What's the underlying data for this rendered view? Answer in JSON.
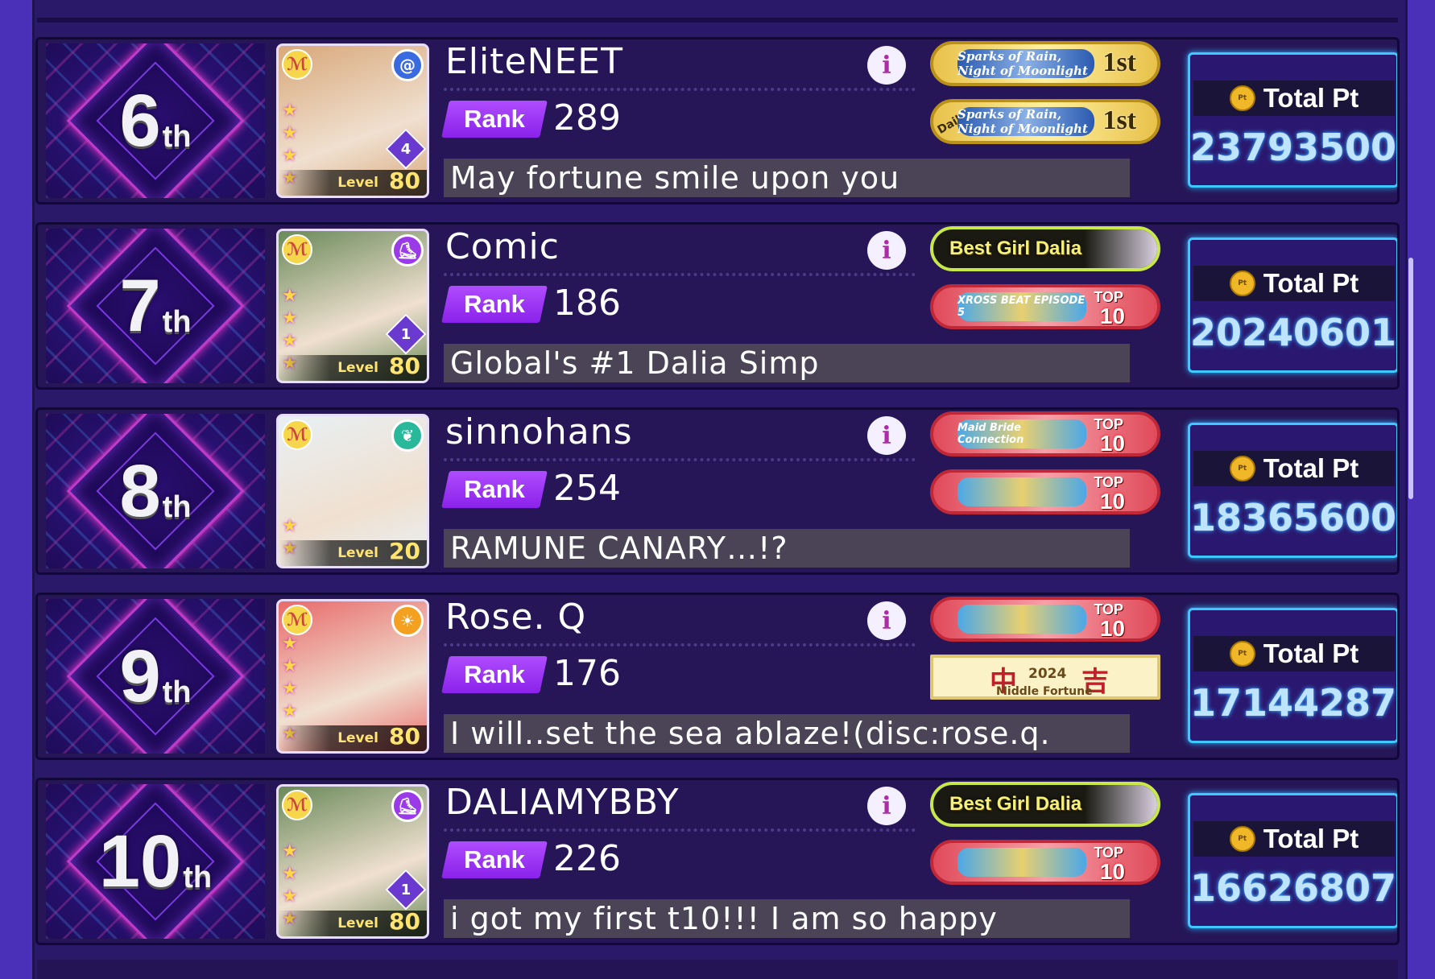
{
  "labels": {
    "rank": "Rank",
    "level": "Level",
    "total_pt": "Total Pt",
    "coin": "Pt"
  },
  "rows": [
    {
      "place": "6",
      "suffix": "th",
      "name": "EliteNEET",
      "rank": "289",
      "comment": "May fortune smile upon you",
      "card": {
        "level": "80",
        "train": "4",
        "attr_color": "#3a6ae0",
        "attr_icon": "spiral-icon",
        "band_icon": "band-logo-icon",
        "bg": "#d8a87a",
        "stars": 4
      },
      "badges": [
        {
          "style": "gold",
          "art": "Sparks of Rain, Night of Moonlight",
          "place": "1st",
          "daily": ""
        },
        {
          "style": "gold",
          "art": "Sparks of Rain, Night of Moonlight",
          "place": "1st",
          "daily": "Daily"
        }
      ],
      "total_pt": "23793500"
    },
    {
      "place": "7",
      "suffix": "th",
      "name": "Comic",
      "rank": "186",
      "comment": "Global's #1 Dalia Simp",
      "card": {
        "level": "80",
        "train": "1",
        "attr_color": "#9a3ae8",
        "attr_icon": "shoe-icon",
        "band_icon": "band-logo-icon",
        "bg": "#6a8a5a",
        "stars": 4
      },
      "badges": [
        {
          "style": "dark",
          "text": "Best Girl Dalia"
        },
        {
          "style": "red",
          "art": "XROSS BEAT EPISODE 5",
          "top": "TOP",
          "ten": "10"
        }
      ],
      "total_pt": "20240601"
    },
    {
      "place": "8",
      "suffix": "th",
      "name": "sinnohans",
      "rank": "254",
      "comment": "RAMUNE CANARY…!?",
      "card": {
        "level": "20",
        "train": "",
        "attr_color": "#2ab89a",
        "attr_icon": "leaf-icon",
        "band_icon": "band-logo-icon",
        "bg": "#e8f0f4",
        "stars": 2
      },
      "badges": [
        {
          "style": "red",
          "art": "Maid Bride Connection",
          "top": "TOP",
          "ten": "10"
        },
        {
          "style": "red",
          "art": "",
          "top": "TOP",
          "ten": "10"
        }
      ],
      "total_pt": "18365600"
    },
    {
      "place": "9",
      "suffix": "th",
      "name": "Rose. Q",
      "rank": "176",
      "comment": "I will..set the sea ablaze!(disc:rose.q.",
      "card": {
        "level": "80",
        "train": "",
        "attr_color": "#f4a020",
        "attr_icon": "sun-icon",
        "band_icon": "band-logo-icon",
        "bg": "#e86a6a",
        "stars": 5
      },
      "badges": [
        {
          "style": "red",
          "art": "",
          "top": "TOP",
          "ten": "10"
        },
        {
          "style": "fortune",
          "k1": "中",
          "year": "2024",
          "k2": "吉",
          "sub": "Middle Fortune"
        }
      ],
      "total_pt": "17144287"
    },
    {
      "place": "10",
      "suffix": "th",
      "name": "DALIAMYBBY",
      "rank": "226",
      "comment": "i got my first t10!!! I am so happy",
      "card": {
        "level": "80",
        "train": "1",
        "attr_color": "#9a3ae8",
        "attr_icon": "shoe-icon",
        "band_icon": "band-logo-icon",
        "bg": "#6a8a5a",
        "stars": 4
      },
      "badges": [
        {
          "style": "dark",
          "text": "Best Girl Dalia"
        },
        {
          "style": "red",
          "art": "",
          "top": "TOP",
          "ten": "10"
        }
      ],
      "total_pt": "16626807"
    }
  ]
}
